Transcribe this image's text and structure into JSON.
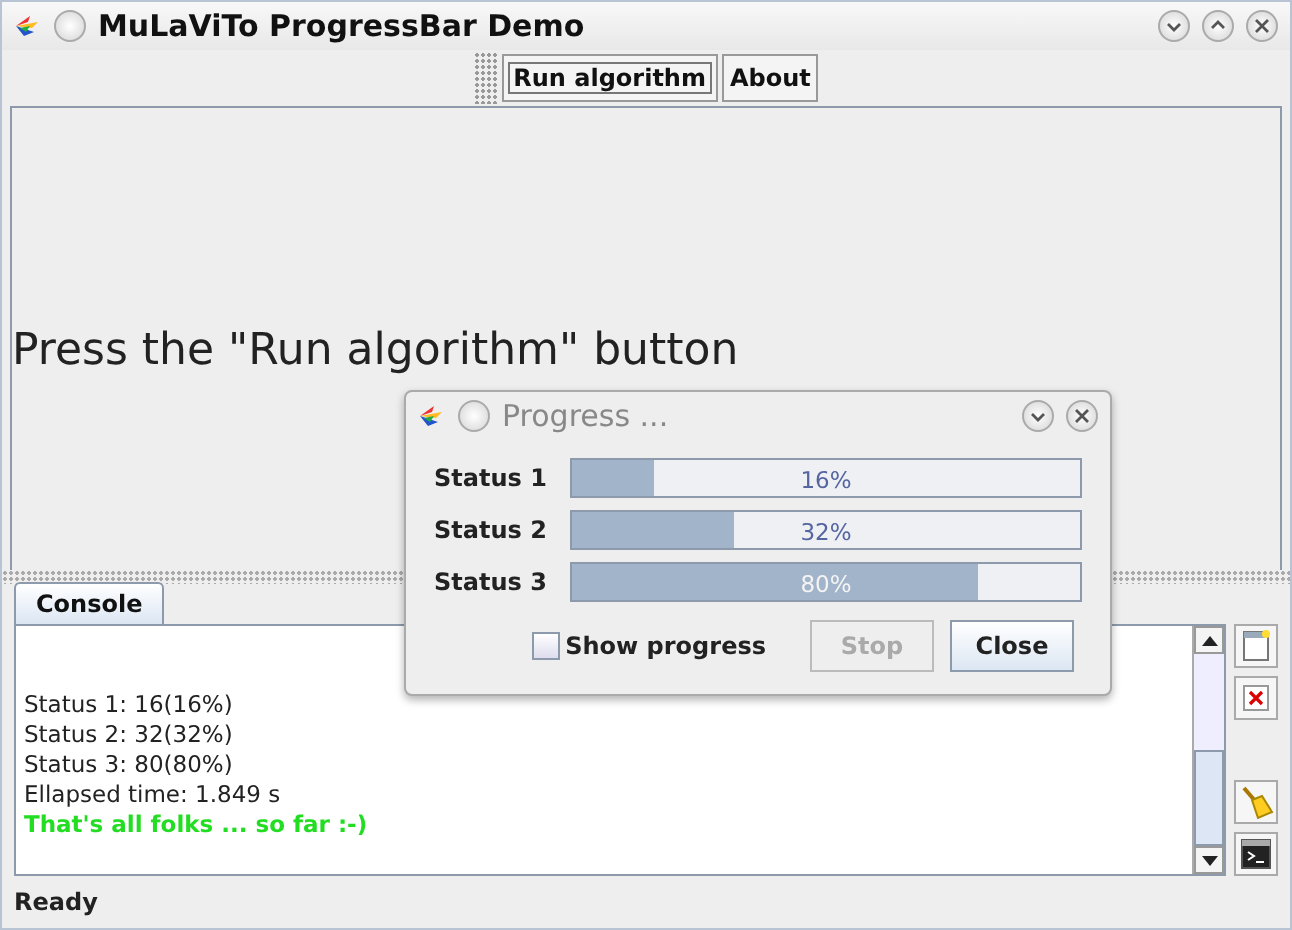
{
  "window": {
    "title": "MuLaViTo ProgressBar Demo"
  },
  "toolbar": [
    {
      "label": "Run algorithm",
      "focused": true
    },
    {
      "label": "About",
      "focused": false
    }
  ],
  "main_message": "Press the \"Run algorithm\" button",
  "console": {
    "tabs": [
      {
        "label": "Console",
        "selected": true
      }
    ],
    "lines": [
      {
        "text": "Status 1: 16(16%)",
        "kind": "normal"
      },
      {
        "text": "Status 2: 32(32%)",
        "kind": "normal"
      },
      {
        "text": "Status 3: 80(80%)",
        "kind": "normal"
      },
      {
        "text": "Ellapsed time: 1.849 s",
        "kind": "normal"
      },
      {
        "text": "That's all folks ... so far :-)",
        "kind": "success"
      }
    ]
  },
  "status_bar": "Ready",
  "dialog": {
    "title": "Progress ...",
    "bars": [
      {
        "label": "Status 1",
        "level": 0.16,
        "reading": "16%"
      },
      {
        "label": "Status 2",
        "level": 0.32,
        "reading": "32%"
      },
      {
        "label": "Status 3",
        "level": 0.8,
        "reading": "80%"
      }
    ],
    "show_progress": {
      "label": "Show progress",
      "checked": false
    },
    "buttons": [
      {
        "label": "Stop",
        "disabled": true
      },
      {
        "label": "Close",
        "disabled": false
      }
    ]
  }
}
